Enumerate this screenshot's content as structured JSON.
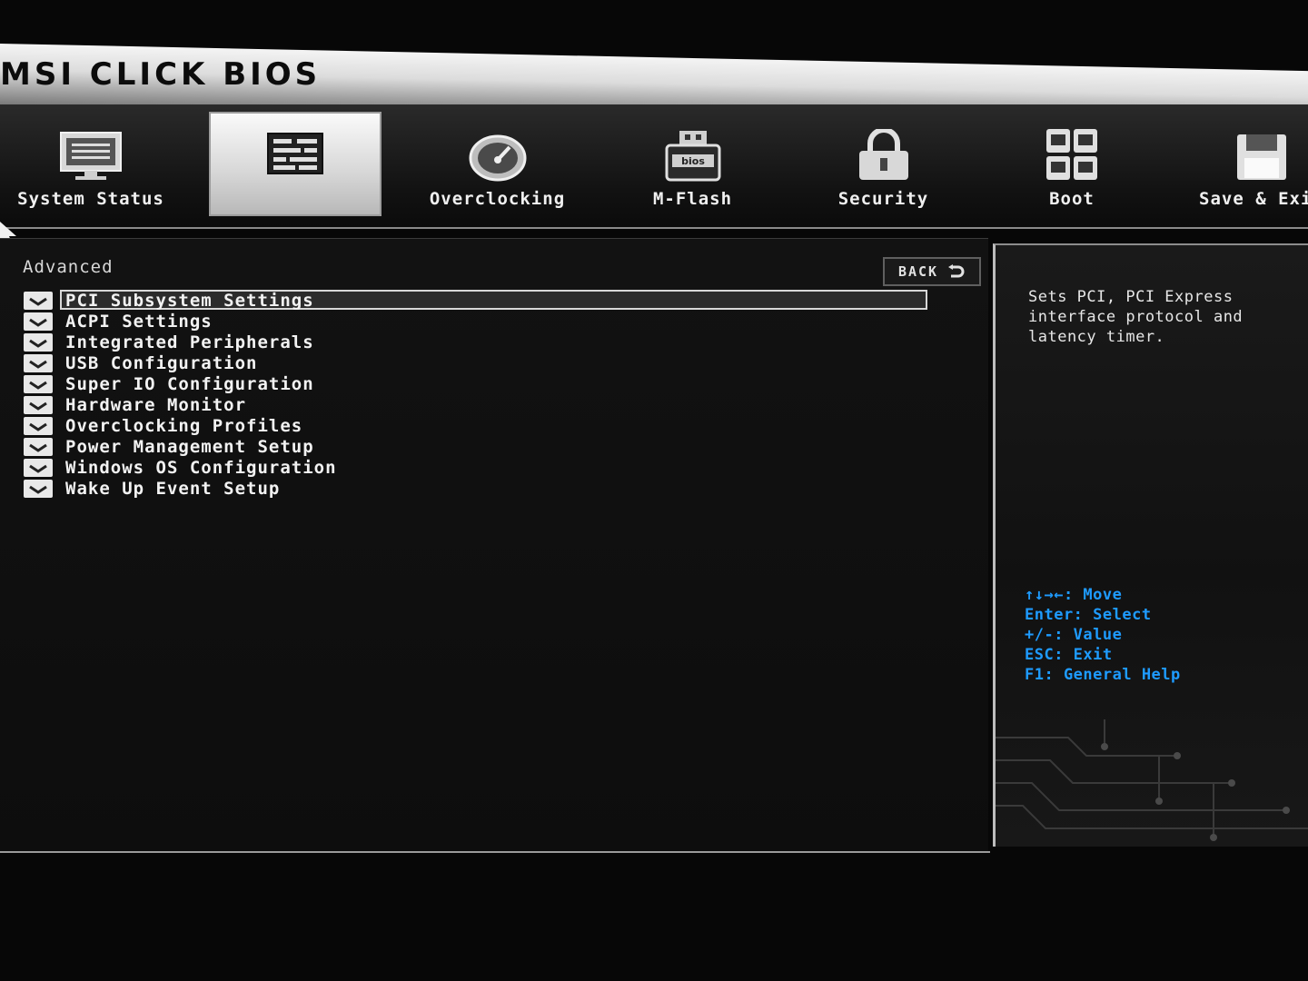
{
  "brand": {
    "text": "MSI CLICK BIOS"
  },
  "nav": [
    {
      "label": "System Status",
      "icon": "monitor-icon"
    },
    {
      "label": "",
      "icon": "settings-panel-icon",
      "active": true
    },
    {
      "label": "Overclocking",
      "icon": "gauge-icon"
    },
    {
      "label": "M-Flash",
      "icon": "usb-bios-icon"
    },
    {
      "label": "Security",
      "icon": "lock-icon"
    },
    {
      "label": "Boot",
      "icon": "boot-grid-icon"
    },
    {
      "label": "Save & Exi",
      "icon": "floppy-icon"
    }
  ],
  "main": {
    "title": "Advanced",
    "back_label": "BACK",
    "items": [
      {
        "label": "PCI Subsystem Settings",
        "selected": true
      },
      {
        "label": "ACPI Settings"
      },
      {
        "label": "Integrated Peripherals"
      },
      {
        "label": "USB Configuration"
      },
      {
        "label": "Super IO Configuration"
      },
      {
        "label": "Hardware Monitor"
      },
      {
        "label": "Overclocking Profiles"
      },
      {
        "label": "Power Management Setup"
      },
      {
        "label": "Windows OS Configuration"
      },
      {
        "label": "Wake Up Event Setup"
      }
    ]
  },
  "help": {
    "description": "Sets PCI, PCI Express interface protocol and latency timer.",
    "keys": [
      "↑↓→←: Move",
      "Enter: Select",
      "+/-: Value",
      "ESC: Exit",
      "F1: General Help"
    ]
  },
  "colors": {
    "accent_blue": "#1e9bff",
    "panel_bg": "#111111",
    "text": "#f2f2f2"
  }
}
